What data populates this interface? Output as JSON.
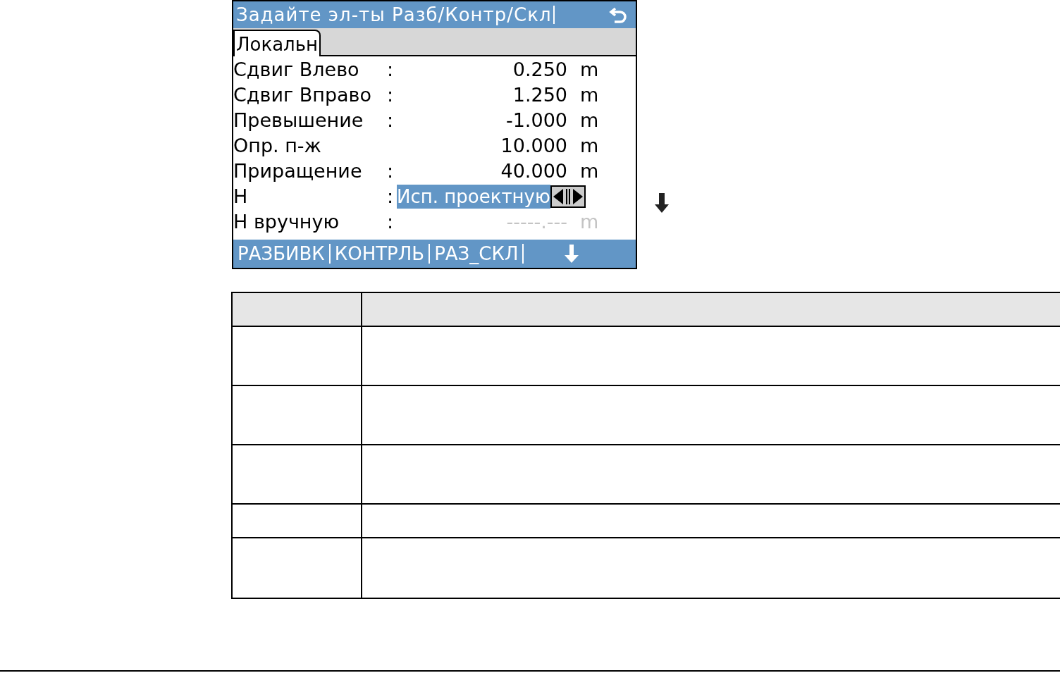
{
  "screen": {
    "title": "Задайте эл-ты Разб/Контр/Скл",
    "tabs": [
      {
        "label": "Локальн",
        "selected": true
      }
    ],
    "rows": [
      {
        "label": "Сдвиг Влево",
        "separator": ":",
        "value": "0.250",
        "unit": "m",
        "kind": "number",
        "selected": false,
        "disabled": false
      },
      {
        "label": "Сдвиг Вправо",
        "separator": ":",
        "value": "1.250",
        "unit": "m",
        "kind": "number",
        "selected": false,
        "disabled": false
      },
      {
        "label": "Превышение",
        "separator": ":",
        "value": "-1.000",
        "unit": "m",
        "kind": "number",
        "selected": false,
        "disabled": false
      },
      {
        "label": "Опр. п-ж",
        "value": "10.000",
        "unit": "m",
        "kind": "number",
        "selected": false,
        "disabled": false
      },
      {
        "label": "Приращение",
        "separator": ":",
        "value": "40.000",
        "unit": "m",
        "kind": "number",
        "selected": false,
        "disabled": false
      },
      {
        "label": "H",
        "separator": ":",
        "value": "Исп. проектную",
        "kind": "choice",
        "selected": true,
        "disabled": false
      },
      {
        "label": "H вручную",
        "separator": ":",
        "value": "-----.---",
        "unit": "m",
        "kind": "number",
        "selected": false,
        "disabled": true
      }
    ],
    "softkeys": [
      "РАЗБИВК",
      "КОНТРЛЬ",
      "РАЗ_СКЛ"
    ]
  }
}
